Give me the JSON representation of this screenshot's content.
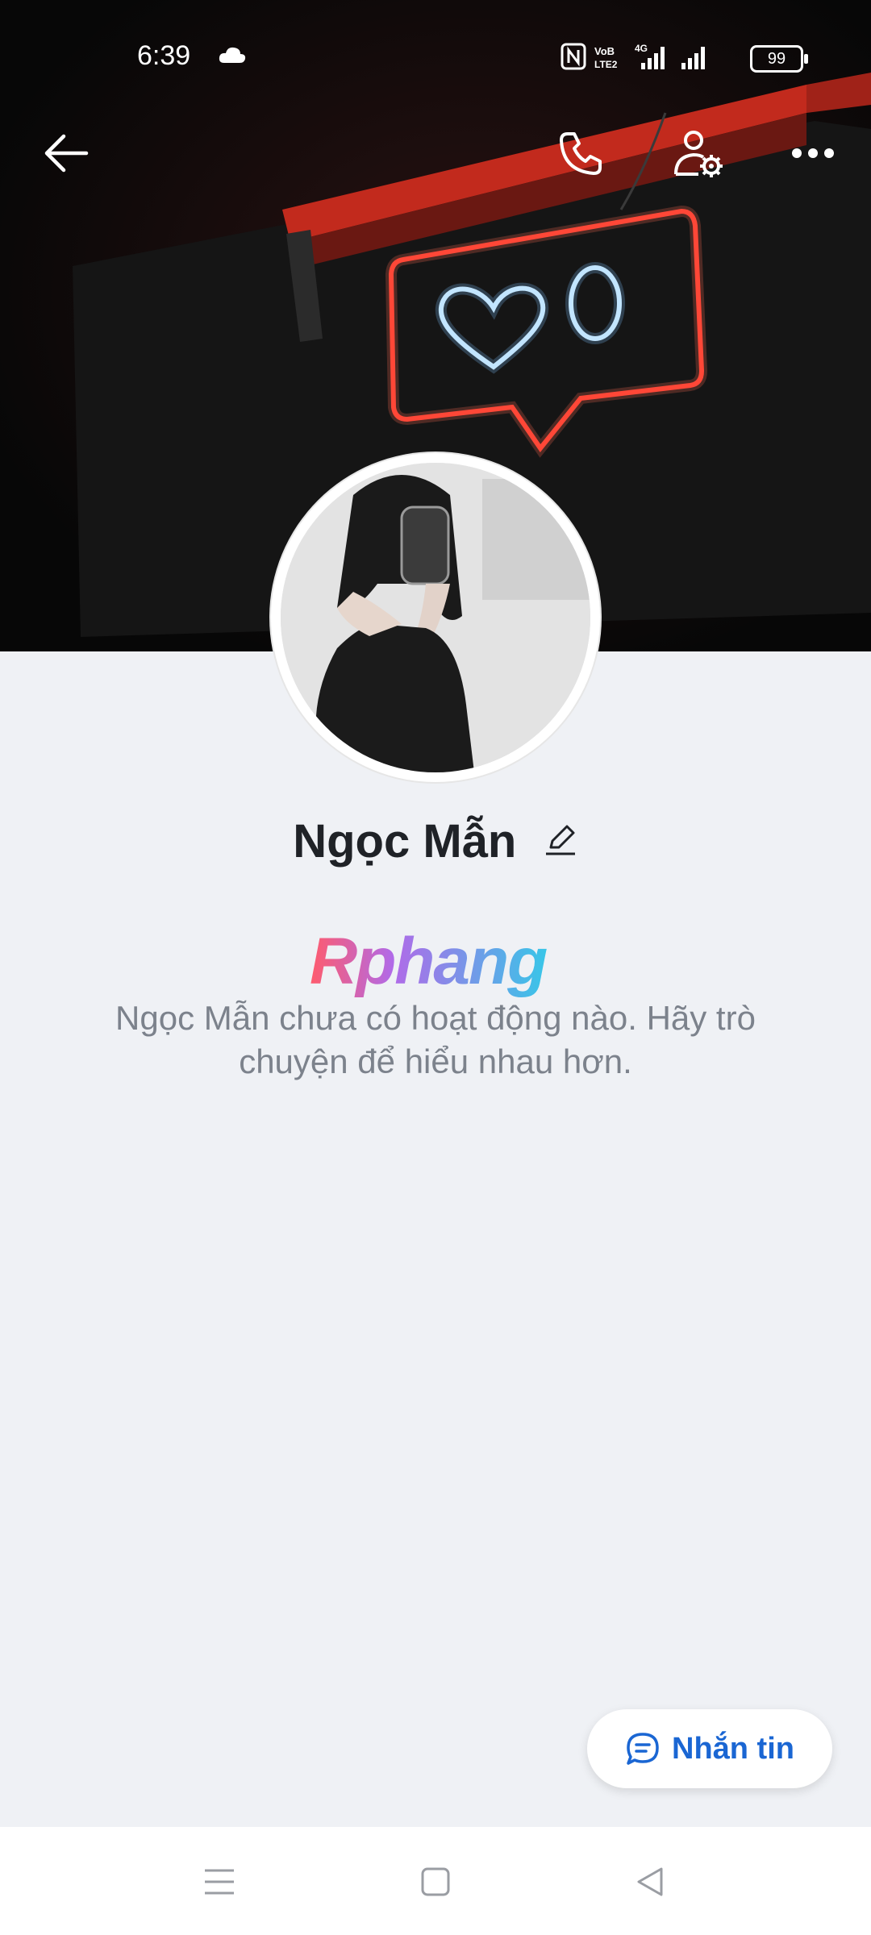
{
  "status_bar": {
    "time": "6:39",
    "battery": "99",
    "icons": [
      "cloud-icon",
      "nfc-icon",
      "volte-icon",
      "4g-signal-icon",
      "signal-icon",
      "battery-icon"
    ]
  },
  "header": {
    "back_icon": "arrow-left-icon",
    "call_icon": "phone-icon",
    "settings_icon": "user-settings-icon",
    "more_icon": "more-dots-icon"
  },
  "profile": {
    "name": "Ngọc Mẫn",
    "empty_activity": "Ngọc Mẫn chưa có hoạt động nào. Hãy trò chuyện để hiểu nhau hơn."
  },
  "watermark": {
    "text": "Rphang"
  },
  "actions": {
    "message_label": "Nhắn tin"
  },
  "colors": {
    "accent": "#1a66d3",
    "background": "#eff1f5",
    "neon_red": "#ff3b2e",
    "neon_blue": "#bfe4ff"
  }
}
